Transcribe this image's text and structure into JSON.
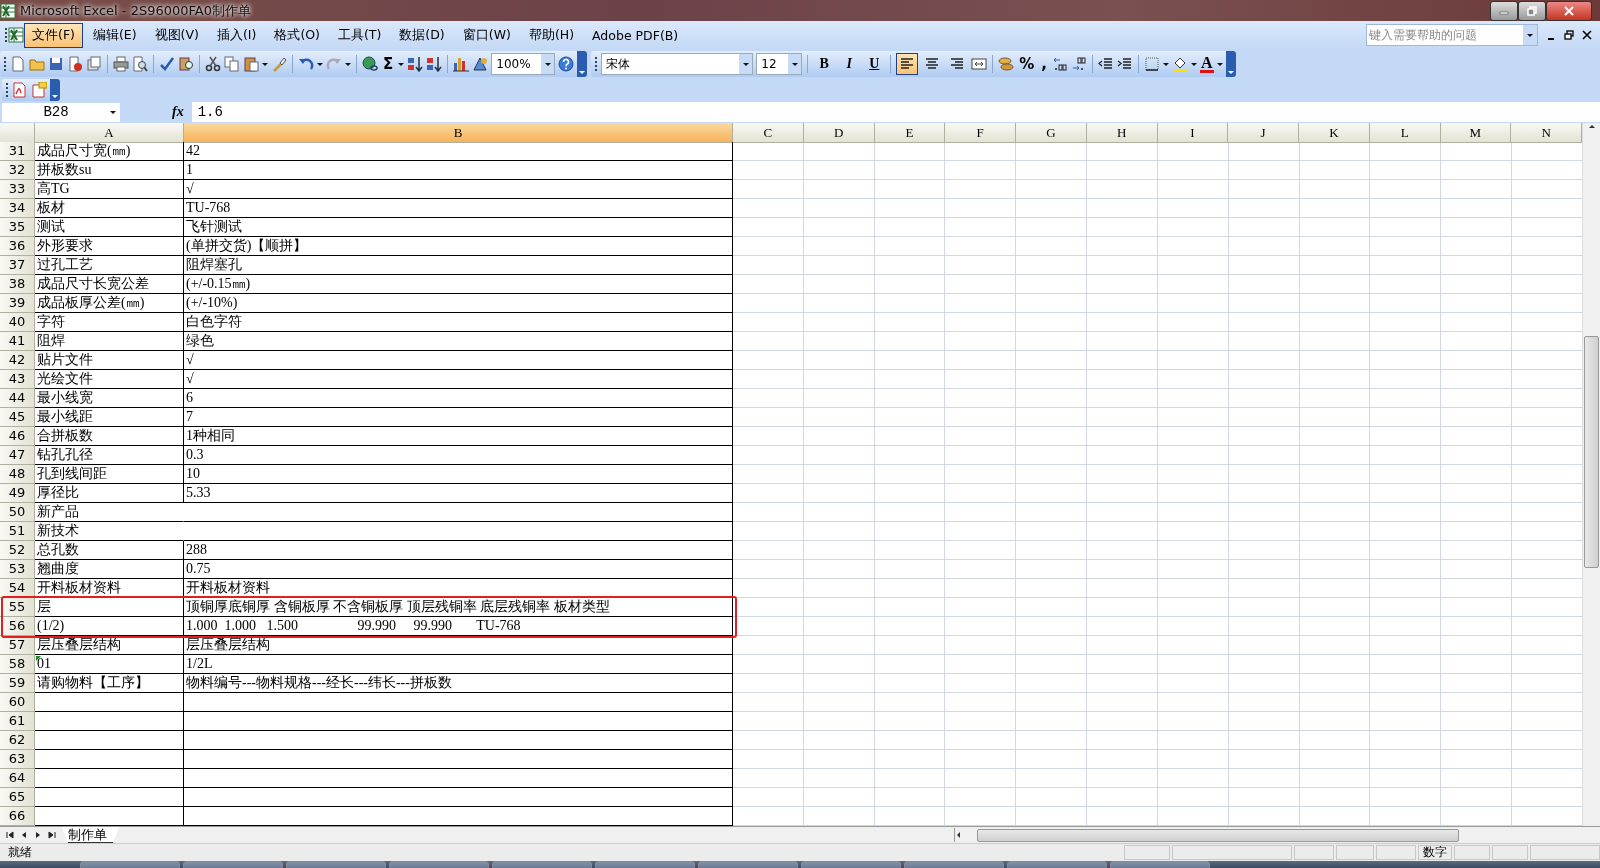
{
  "window": {
    "title": "Microsoft Excel - 2S96000FA0制作单"
  },
  "menu": [
    {
      "label": "文件(F)",
      "selected": true
    },
    {
      "label": "编辑(E)",
      "selected": false
    },
    {
      "label": "视图(V)",
      "selected": false
    },
    {
      "label": "插入(I)",
      "selected": false
    },
    {
      "label": "格式(O)",
      "selected": false
    },
    {
      "label": "工具(T)",
      "selected": false
    },
    {
      "label": "数据(D)",
      "selected": false
    },
    {
      "label": "窗口(W)",
      "selected": false
    },
    {
      "label": "帮助(H)",
      "selected": false
    },
    {
      "label": "Adobe PDF(B)",
      "selected": false
    }
  ],
  "help_search": {
    "placeholder": "键入需要帮助的问题"
  },
  "standard_toolbar": {
    "sum": "Σ",
    "zoom": "100%"
  },
  "format_toolbar": {
    "font": "宋体",
    "size": "12",
    "styles": [
      {
        "label": "B",
        "selected": false
      },
      {
        "label": "I",
        "selected": false
      },
      {
        "label": "U",
        "selected": false
      }
    ],
    "align": [
      {
        "selected": true
      },
      {
        "selected": false
      },
      {
        "selected": false
      }
    ],
    "percent": "%",
    "comma": ",",
    "font_color": "A"
  },
  "formula_bar": {
    "name_box": "B28",
    "fx": "fx",
    "value": "1.6"
  },
  "columns": [
    {
      "label": "A",
      "selected": false
    },
    {
      "label": "B",
      "selected": true
    },
    {
      "label": "C",
      "selected": false
    },
    {
      "label": "D",
      "selected": false
    },
    {
      "label": "E",
      "selected": false
    },
    {
      "label": "F",
      "selected": false
    },
    {
      "label": "G",
      "selected": false
    },
    {
      "label": "H",
      "selected": false
    },
    {
      "label": "I",
      "selected": false
    },
    {
      "label": "J",
      "selected": false
    },
    {
      "label": "K",
      "selected": false
    },
    {
      "label": "L",
      "selected": false
    },
    {
      "label": "M",
      "selected": false
    },
    {
      "label": "N",
      "selected": false
    }
  ],
  "rows": [
    {
      "number": "31",
      "a": "成品尺寸宽(㎜)",
      "b": "42"
    },
    {
      "number": "32",
      "a": "拼板数su",
      "b": "1"
    },
    {
      "number": "33",
      "a": "高TG",
      "b": "√"
    },
    {
      "number": "34",
      "a": "板材",
      "b": "TU-768"
    },
    {
      "number": "35",
      "a": "测试",
      "b": "飞针测试"
    },
    {
      "number": "36",
      "a": "外形要求",
      "b": "(单拼交货)【顺拼】"
    },
    {
      "number": "37",
      "a": "过孔工艺",
      "b": "阻焊塞孔"
    },
    {
      "number": "38",
      "a": "成品尺寸长宽公差",
      "b": "(+/-0.15㎜)"
    },
    {
      "number": "39",
      "a": "成品板厚公差(㎜)",
      "b": "(+/-10%)"
    },
    {
      "number": "40",
      "a": "字符",
      "b": "白色字符"
    },
    {
      "number": "41",
      "a": "阻焊",
      "b": "绿色"
    },
    {
      "number": "42",
      "a": "贴片文件",
      "b": "√"
    },
    {
      "number": "43",
      "a": "光绘文件",
      "b": "√"
    },
    {
      "number": "44",
      "a": "最小线宽",
      "b": "6"
    },
    {
      "number": "45",
      "a": "最小线距",
      "b": "7"
    },
    {
      "number": "46",
      "a": "合拼板数",
      "b": "1种相同"
    },
    {
      "number": "47",
      "a": "钻孔孔径",
      "b": "0.3"
    },
    {
      "number": "48",
      "a": "孔到线间距",
      "b": "10"
    },
    {
      "number": "49",
      "a": "厚径比",
      "b": "5.33"
    },
    {
      "number": "50",
      "a": "新产品"
    },
    {
      "number": "51",
      "a": "新技术"
    },
    {
      "number": "52",
      "a": "总孔数",
      "b": "288"
    },
    {
      "number": "53",
      "a": "翘曲度",
      "b": "0.75"
    },
    {
      "number": "54",
      "a": "开料板材资料",
      "b": "开料板材资料"
    },
    {
      "number": "55",
      "a": "层",
      "b": "顶铜厚底铜厚 含铜板厚 不含铜板厚 顶层残铜率 底层残铜率 板材类型",
      "highlight": true
    },
    {
      "number": "56",
      "a": "(1/2)",
      "b": "1.000  1.000   1.500                 99.990     99.990       TU-768",
      "highlight": true
    },
    {
      "number": "57",
      "a": "层压叠层结构",
      "b": "层压叠层结构"
    },
    {
      "number": "58",
      "a": "01",
      "b": "1/2L",
      "error_mark": true
    },
    {
      "number": "59",
      "a": "请购物料【工序】",
      "b": "物料编号---物料规格---经长---纬长---拼板数"
    },
    {
      "number": "60"
    },
    {
      "number": "61"
    },
    {
      "number": "62"
    },
    {
      "number": "63"
    },
    {
      "number": "64"
    },
    {
      "number": "65"
    },
    {
      "number": "66"
    }
  ],
  "sheet_tabs": [
    {
      "label": "制作单",
      "selected": true
    }
  ],
  "status_bar": {
    "left": "就绪",
    "mode": "数字"
  }
}
